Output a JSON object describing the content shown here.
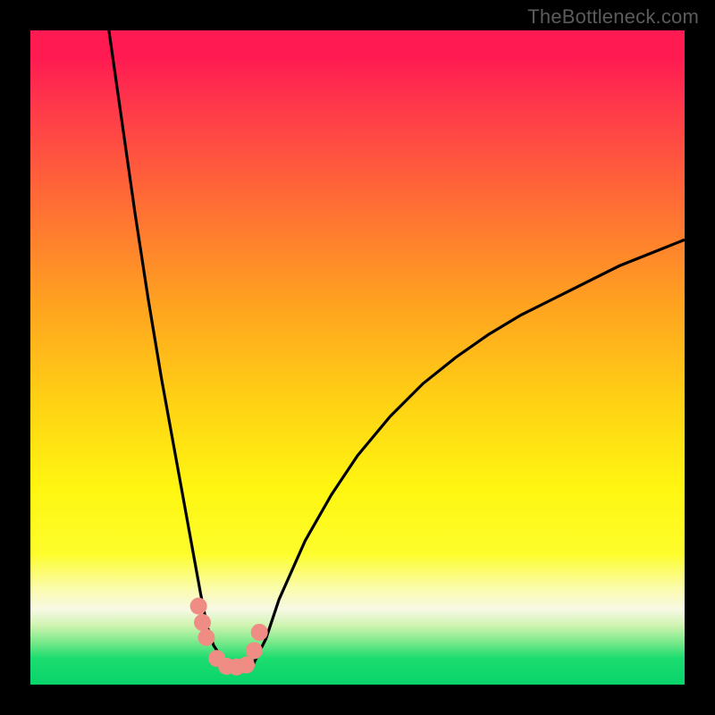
{
  "watermark": "TheBottleneck.com",
  "colors": {
    "frame": "#000000",
    "gradient_top": "#ff1a52",
    "gradient_bottom": "#08d46a",
    "curve_stroke": "#000000",
    "marker_fill": "#ef8c84"
  },
  "chart_data": {
    "type": "line",
    "title": "",
    "xlabel": "",
    "ylabel": "",
    "xlim": [
      0,
      100
    ],
    "ylim": [
      0,
      100
    ],
    "notes": "Bottleneck percentage curve. Y is bottleneck % (0 at bottom = green/good, 100 at top = red/bad). Minimum plateau around x≈27–34 at y≈2.5. Left branch rises steeply past 100 at x≈12; right branch reaches ~68 at x=100.",
    "series": [
      {
        "name": "bottleneck-curve",
        "x": [
          12,
          14,
          16,
          18,
          20,
          22,
          24,
          26,
          27,
          28,
          30,
          32,
          33,
          34,
          36,
          38,
          42,
          46,
          50,
          55,
          60,
          65,
          70,
          75,
          80,
          85,
          90,
          95,
          100
        ],
        "y": [
          100,
          86,
          72,
          59,
          47,
          36,
          25,
          14,
          9,
          6,
          3,
          2.5,
          2.5,
          3,
          7,
          13,
          22,
          29,
          35,
          41,
          46,
          50,
          53.5,
          56.5,
          59,
          61.5,
          64,
          66,
          68
        ]
      }
    ],
    "markers": {
      "name": "optimum-points",
      "x": [
        25.7,
        26.3,
        26.9,
        28.5,
        30.0,
        31.5,
        33.0,
        34.2,
        35.0
      ],
      "y": [
        12.0,
        9.5,
        7.2,
        4.0,
        2.8,
        2.7,
        3.0,
        5.2,
        8.0
      ]
    }
  }
}
